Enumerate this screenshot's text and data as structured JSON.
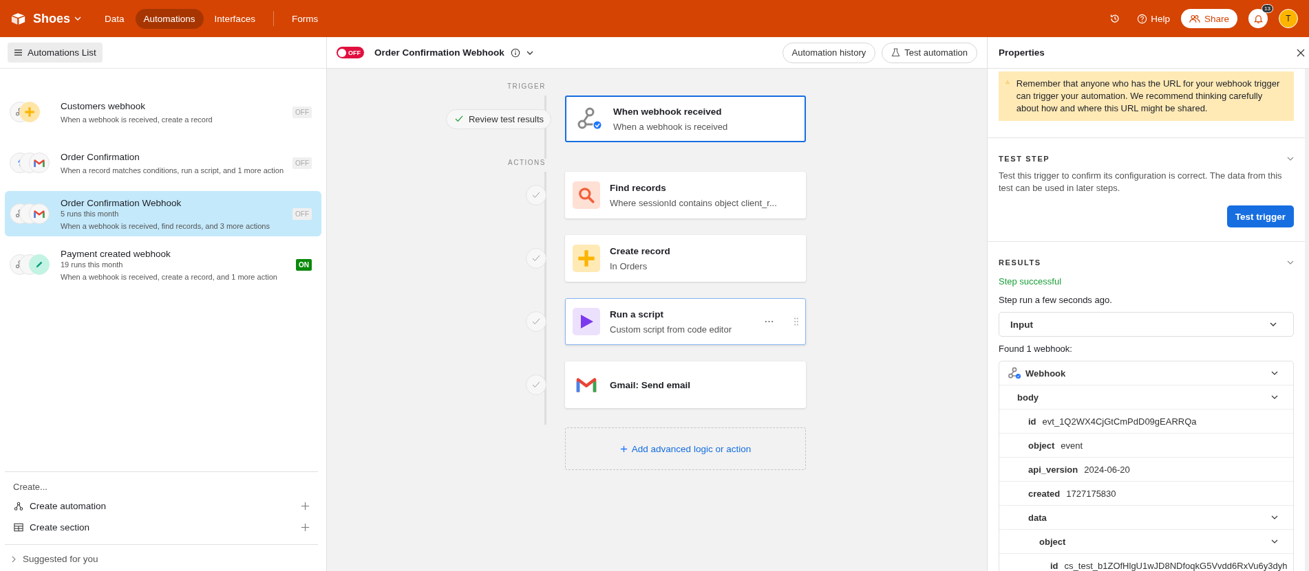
{
  "topbar": {
    "base_name": "Shoes",
    "nav": [
      {
        "label": "Data",
        "selected": false
      },
      {
        "label": "Automations",
        "selected": true
      },
      {
        "label": "Interfaces",
        "selected": false
      },
      {
        "label": "Forms",
        "selected": false
      }
    ],
    "help": "Help",
    "share": "Share",
    "notifications": "13",
    "avatar": "T"
  },
  "sidebar": {
    "list_button": "Automations List",
    "automations": [
      {
        "title": "Customers webhook",
        "description": "When a webhook is received, create a record",
        "status": "OFF",
        "on": false,
        "selected": false,
        "icons": [
          {
            "kind": "webhook"
          },
          {
            "kind": "create"
          }
        ]
      },
      {
        "title": "Order Confirmation",
        "description": "When a record matches conditions, run a script, and 1 more action",
        "status": "OFF",
        "on": false,
        "selected": false,
        "icons": [
          {
            "kind": "record"
          },
          {
            "kind": "blank"
          },
          {
            "kind": "gmail"
          }
        ]
      },
      {
        "title": "Order Confirmation Webhook",
        "runs": "5 runs this month",
        "description": "When a webhook is received, find records, and 3 more actions",
        "status": "OFF",
        "on": false,
        "selected": true,
        "icons": [
          {
            "kind": "webhook"
          },
          {
            "kind": "blank"
          },
          {
            "kind": "gmail"
          }
        ]
      },
      {
        "title": "Payment created webhook",
        "runs": "19 runs this month",
        "description": "When a webhook is received, create a record, and 1 more action",
        "status": "ON",
        "on": true,
        "selected": false,
        "icons": [
          {
            "kind": "webhook"
          },
          {
            "kind": "blank"
          },
          {
            "kind": "edit"
          }
        ]
      }
    ],
    "create_heading": "Create...",
    "create_items": [
      {
        "kind": "automation",
        "label": "Create automation"
      },
      {
        "kind": "section",
        "label": "Create section"
      }
    ],
    "suggested": "Suggested for you"
  },
  "editor": {
    "toggle": {
      "label": "OFF",
      "on": false
    },
    "title": "Order Confirmation Webhook",
    "history_button": "Automation history",
    "test_button": "Test automation",
    "trigger_label": "TRIGGER",
    "actions_label": "ACTIONS",
    "review_button": "Review test results",
    "trigger": {
      "kind": "webhook",
      "title": "When webhook received",
      "subtitle": "When a webhook is received",
      "selected": true
    },
    "actions": [
      {
        "kind": "find",
        "title": "Find records",
        "subtitle": "Where sessionId contains object client_r...",
        "done": true,
        "selected": false,
        "hovered": false
      },
      {
        "kind": "create",
        "title": "Create record",
        "subtitle": "In Orders",
        "done": true,
        "selected": false,
        "hovered": false
      },
      {
        "kind": "script",
        "title": "Run a script",
        "subtitle": "Custom script from code editor",
        "done": true,
        "selected": false,
        "hovered": true
      },
      {
        "kind": "gmail",
        "title": "Gmail: Send email",
        "done": true,
        "selected": false,
        "hovered": false
      }
    ],
    "add_button": "Add advanced logic or action"
  },
  "properties": {
    "title": "Properties",
    "warning": "Remember that anyone who has the URL for your webhook trigger can trigger your automation. We recommend thinking carefully about how and where this URL might be shared.",
    "test_step": {
      "heading": "TEST STEP",
      "description": "Test this trigger to confirm its configuration is correct. The data from this test can be used in later steps.",
      "button": "Test trigger"
    },
    "results": {
      "heading": "RESULTS",
      "status": "Step successful",
      "time": "Step run a few seconds ago.",
      "input_dropdown": "Input",
      "found": "Found 1 webhook:",
      "tree": [
        {
          "label": "Webhook",
          "kind": "webhook",
          "expanded": true,
          "children": [
            {
              "label": "body",
              "expanded": true,
              "children": [
                {
                  "label": "id",
                  "value": "evt_1Q2WX4CjGtCmPdD09gEARRQa"
                },
                {
                  "label": "object",
                  "value": "event"
                },
                {
                  "label": "api_version",
                  "value": "2024-06-20"
                },
                {
                  "label": "created",
                  "value": "1727175830"
                },
                {
                  "label": "data",
                  "expanded": true,
                  "children": [
                    {
                      "label": "object",
                      "expanded": true,
                      "children": [
                        {
                          "label": "id",
                          "value": "cs_test_b1ZOfHlgU1wJD8NDfoqkG5Vvdd6RxVu6y3dyh"
                        }
                      ]
                    }
                  ]
                }
              ]
            }
          ]
        }
      ]
    }
  }
}
